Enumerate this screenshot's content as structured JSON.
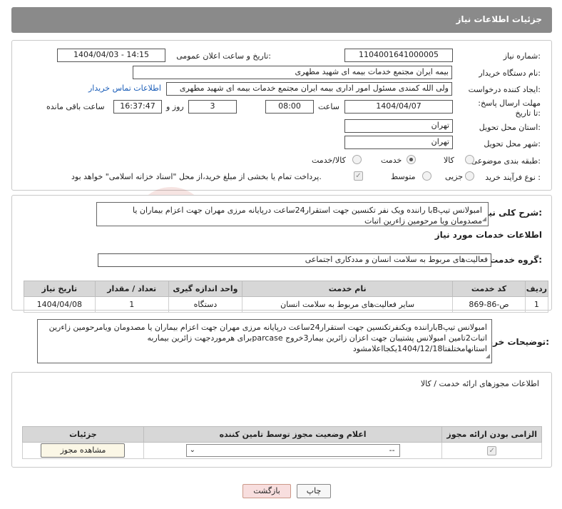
{
  "header": {
    "title": "جزئیات اطلاعات نیاز"
  },
  "form": {
    "need_number_label": "شماره نیاز:",
    "need_number": "1104001641000005",
    "announce_label": "تاریخ و ساعت اعلان عمومی:",
    "announce_value": "1404/04/03 - 14:15",
    "buyer_label": "نام دستگاه خریدار:",
    "buyer_value": "بیمه ایران مجتمع خدمات بیمه ای شهید مطهری",
    "creator_label": "ایجاد کننده درخواست:",
    "creator_value": "ولی الله کمندی مسئول امور اداری بیمه ایران مجتمع خدمات بیمه ای شهید مطهری",
    "contact_link": "اطلاعات تماس خریدار",
    "deadline_label": "مهلت ارسال پاسخ: تا تاریخ:",
    "deadline_date": "1404/04/07",
    "hour_label": "ساعت",
    "deadline_time": "08:00",
    "days_value": "3",
    "days_label": "روز و",
    "remaining_time": "16:37:47",
    "remaining_label": "ساعت باقی مانده",
    "province_label": "استان محل تحویل:",
    "province_value": "تهران",
    "city_label": "شهر محل تحویل:",
    "city_value": "تهران",
    "category_label": "طبقه بندی موضوعی:",
    "category_options": [
      "کالا",
      "خدمت",
      "کالا/خدمت"
    ],
    "category_selected": "خدمت",
    "process_label": "نوع فرآیند خرید :",
    "process_options": [
      "جزیی",
      "متوسط"
    ],
    "payment_text": "پرداخت تمام یا بخشی از مبلغ خرید،از محل \"اسناد خزانه اسلامی\" خواهد بود."
  },
  "summary": {
    "label": "شرح کلی نیاز:",
    "text": "امبولانس تیپBبا راننده ویک نفر تکنسین جهت استقرار24ساعت درپایانه مرزی مهران جهت اعزام بیماران یا مصدومان ویا مرحومین زاءرین اتبات"
  },
  "services": {
    "section_title": "اطلاعات خدمات مورد نیاز",
    "group_label": "گروه خدمت:",
    "group_value": "فعالیت‌های مربوط به سلامت انسان و مددکاری اجتماعی",
    "columns": [
      "ردیف",
      "کد خدمت",
      "نام خدمت",
      "واحد اندازه گیری",
      "تعداد / مقدار",
      "تاریخ نیاز"
    ],
    "rows": [
      {
        "row": "1",
        "code": "ص-86-869",
        "name": "سایر فعالیت‌های مربوط به سلامت انسان",
        "unit": "دستگاه",
        "qty": "1",
        "date": "1404/04/08"
      }
    ]
  },
  "buyer_notes": {
    "label": "توضیحات خریدار:",
    "text": "امبولانس تیپBباراننده ویکنفرتکنسین جهت استقرار24ساعت درپایانه مرزی مهران جهت اعزام بیماران یا مصدومان ویامرحومین زاءرین اتبات2تامین امبولانس پشتیبان جهت اعزان زائرین بیمار3خروج parcaseبرای هرموردجهت زائرین بیماربه استانهامختلفتا1404/12/18یکجااعلامشود"
  },
  "permits": {
    "section_title": "اطلاعات مجوزهای ارائه خدمت / کالا",
    "columns": [
      "الزامی بودن ارائه مجوز",
      "اعلام وضعیت مجوز توسط تامین کننده",
      "جزئیات"
    ],
    "select_value": "--",
    "view_button": "مشاهده مجوز"
  },
  "actions": {
    "print": "چاپ",
    "back": "بازگشت"
  },
  "watermark": {
    "text": "AriaTender.neT"
  },
  "colors": {
    "header_bg": "#8a8a8a",
    "link": "#1a5db8",
    "back_button_bg": "#f8dede",
    "table_header": "#d7d7d7"
  }
}
